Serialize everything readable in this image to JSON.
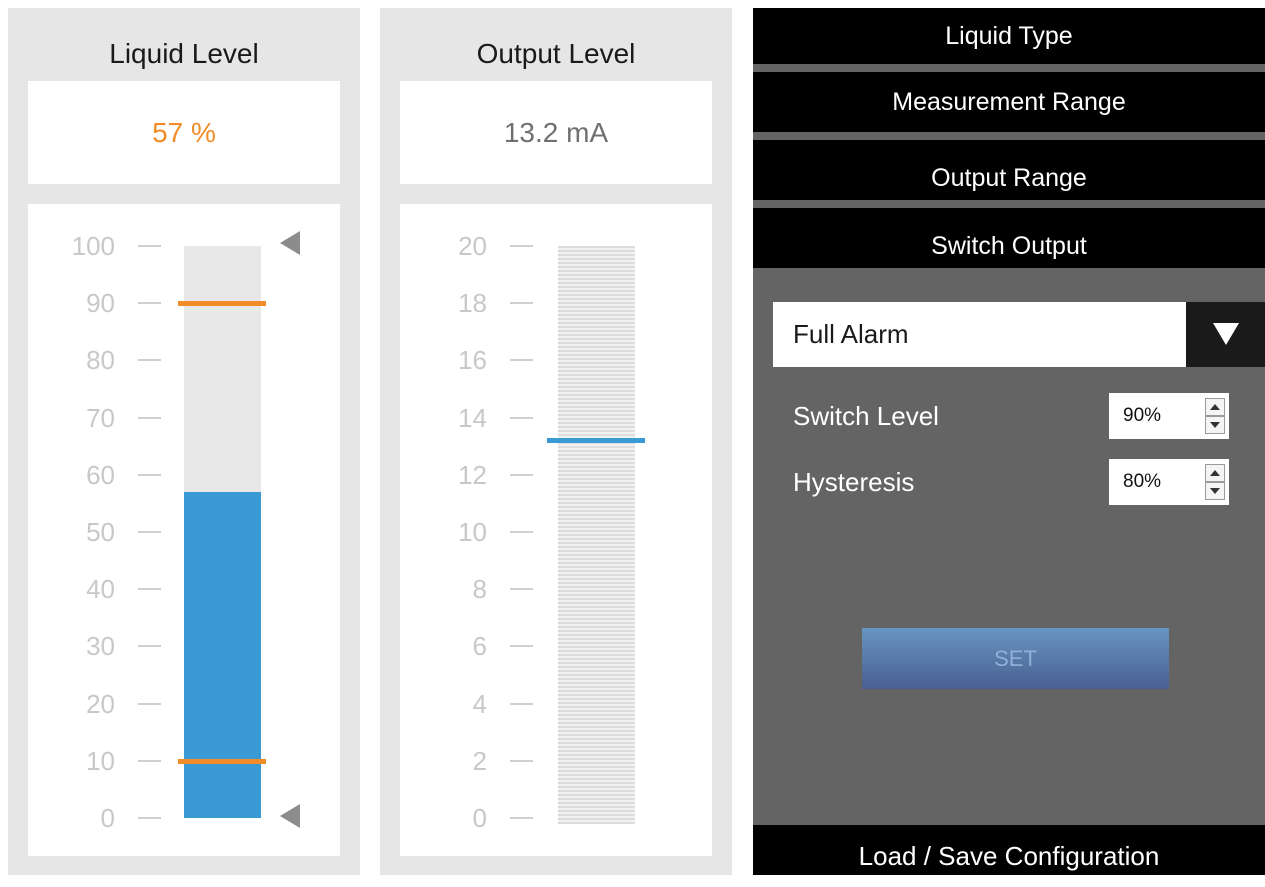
{
  "liquid_level": {
    "title": "Liquid Level",
    "readout": "57 %",
    "value_percent": 57,
    "upper_switch_percent": 90,
    "lower_switch_percent": 10,
    "ticks": [
      "100",
      "90",
      "80",
      "70",
      "60",
      "50",
      "40",
      "30",
      "20",
      "10",
      "0"
    ]
  },
  "output_level": {
    "title": "Output Level",
    "readout": "13.2 mA",
    "value_ma": 13.2,
    "min_ma": 0,
    "max_ma": 20,
    "ticks": [
      "20",
      "18",
      "16",
      "14",
      "12",
      "10",
      "8",
      "6",
      "4",
      "2",
      "0"
    ]
  },
  "menu": {
    "liquid_type": "Liquid Type",
    "measurement_range": "Measurement Range",
    "output_range": "Output Range",
    "switch_output": "Switch Output",
    "load_save": "Load / Save Configuration"
  },
  "switch_output": {
    "mode": "Full Alarm",
    "switch_level_label": "Switch Level",
    "switch_level_value": "90%",
    "hysteresis_label": "Hysteresis",
    "hysteresis_value": "80%",
    "set_label": "SET"
  },
  "colors": {
    "accent_orange": "#f28c28",
    "fill_blue": "#3a9ad4",
    "panel_grey": "#646464",
    "menu_black": "#000000"
  }
}
